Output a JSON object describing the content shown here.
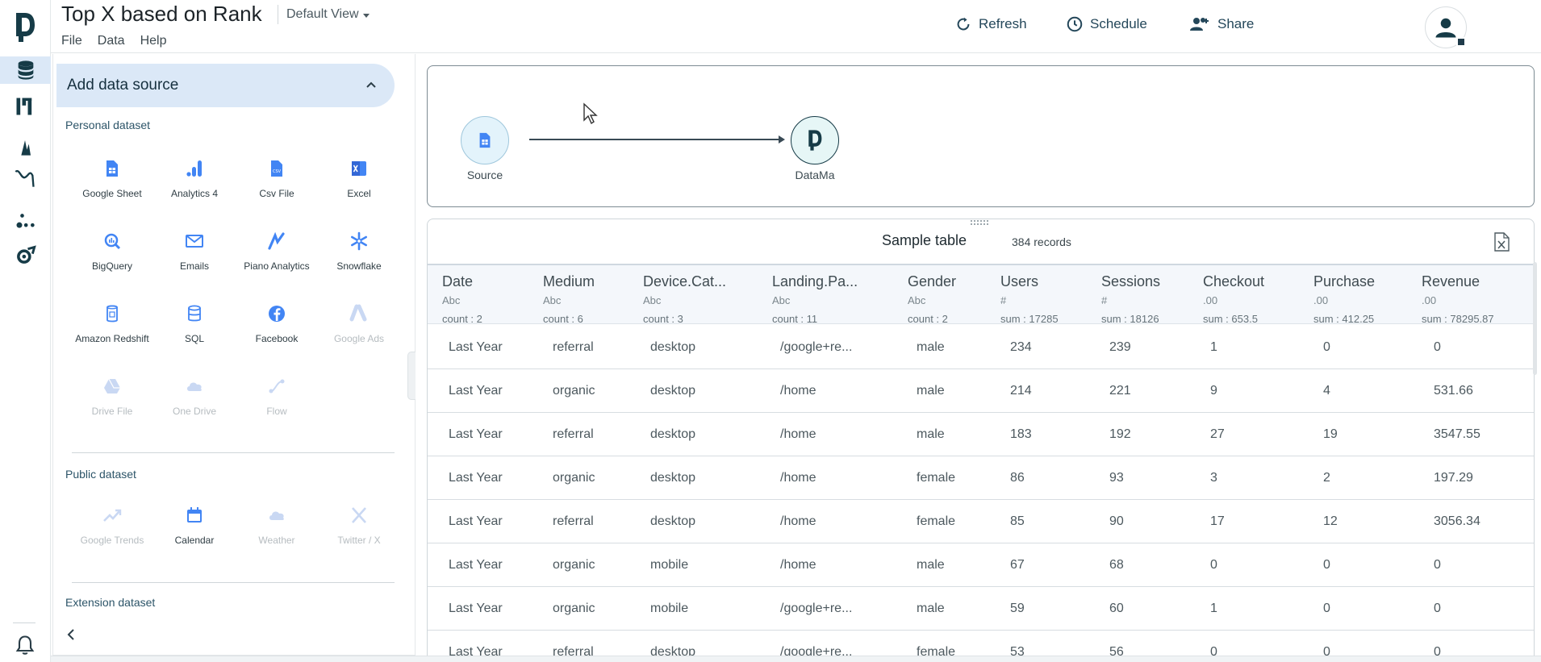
{
  "header": {
    "title": "Top X based on Rank",
    "view_label": "Default View",
    "menu": [
      "File",
      "Data",
      "Help"
    ],
    "refresh_label": "Refresh",
    "schedule_label": "Schedule",
    "share_label": "Share"
  },
  "panel": {
    "add_source_label": "Add data source",
    "personal_title": "Personal dataset",
    "personal": [
      {
        "label": "Google Sheet",
        "icon": "google-sheet-icon",
        "enabled": true
      },
      {
        "label": "Analytics 4",
        "icon": "analytics-icon",
        "enabled": true
      },
      {
        "label": "Csv File",
        "icon": "csv-file-icon",
        "enabled": true
      },
      {
        "label": "Excel",
        "icon": "excel-icon",
        "enabled": true
      },
      {
        "label": "BigQuery",
        "icon": "bigquery-icon",
        "enabled": true
      },
      {
        "label": "Emails",
        "icon": "email-icon",
        "enabled": true
      },
      {
        "label": "Piano Analytics",
        "icon": "piano-analytics-icon",
        "enabled": true
      },
      {
        "label": "Snowflake",
        "icon": "snowflake-icon",
        "enabled": true
      },
      {
        "label": "Amazon Redshift",
        "icon": "redshift-icon",
        "enabled": true
      },
      {
        "label": "SQL",
        "icon": "sql-database-icon",
        "enabled": true
      },
      {
        "label": "Facebook",
        "icon": "facebook-icon",
        "enabled": true
      },
      {
        "label": "Google Ads",
        "icon": "google-ads-icon",
        "enabled": false
      },
      {
        "label": "Drive File",
        "icon": "drive-icon",
        "enabled": false
      },
      {
        "label": "One Drive",
        "icon": "cloud-icon",
        "enabled": false
      },
      {
        "label": "Flow",
        "icon": "flow-icon",
        "enabled": false
      }
    ],
    "public_title": "Public dataset",
    "public": [
      {
        "label": "Google Trends",
        "icon": "trend-icon",
        "enabled": false
      },
      {
        "label": "Calendar",
        "icon": "calendar-icon",
        "enabled": true
      },
      {
        "label": "Weather",
        "icon": "cloud-icon",
        "enabled": false
      },
      {
        "label": "Twitter / X",
        "icon": "x-twitter-icon",
        "enabled": false
      }
    ],
    "extension_title": "Extension dataset"
  },
  "flow": {
    "source_label": "Source",
    "target_label": "DataMa"
  },
  "table": {
    "caption": "Sample table",
    "records": "384 records",
    "columns": [
      {
        "name": "Date",
        "type": "Abc",
        "agg": "count : 2"
      },
      {
        "name": "Medium",
        "type": "Abc",
        "agg": "count : 6"
      },
      {
        "name": "Device.Cat...",
        "type": "Abc",
        "agg": "count : 3"
      },
      {
        "name": "Landing.Pa...",
        "type": "Abc",
        "agg": "count : 11"
      },
      {
        "name": "Gender",
        "type": "Abc",
        "agg": "count : 2"
      },
      {
        "name": "Users",
        "type": "#",
        "agg": "sum : 17285"
      },
      {
        "name": "Sessions",
        "type": "#",
        "agg": "sum : 18126"
      },
      {
        "name": "Checkout",
        "type": ".00",
        "agg": "sum : 653.5"
      },
      {
        "name": "Purchase",
        "type": ".00",
        "agg": "sum : 412.25"
      },
      {
        "name": "Revenue",
        "type": ".00",
        "agg": "sum : 78295.87"
      }
    ],
    "rows": [
      [
        "Last Year",
        "referral",
        "desktop",
        "/google+re...",
        "male",
        "234",
        "239",
        "1",
        "0",
        "0"
      ],
      [
        "Last Year",
        "organic",
        "desktop",
        "/home",
        "male",
        "214",
        "221",
        "9",
        "4",
        "531.66"
      ],
      [
        "Last Year",
        "referral",
        "desktop",
        "/home",
        "male",
        "183",
        "192",
        "27",
        "19",
        "3547.55"
      ],
      [
        "Last Year",
        "organic",
        "desktop",
        "/home",
        "female",
        "86",
        "93",
        "3",
        "2",
        "197.29"
      ],
      [
        "Last Year",
        "referral",
        "desktop",
        "/home",
        "female",
        "85",
        "90",
        "17",
        "12",
        "3056.34"
      ],
      [
        "Last Year",
        "organic",
        "mobile",
        "/home",
        "male",
        "67",
        "68",
        "0",
        "0",
        "0"
      ],
      [
        "Last Year",
        "organic",
        "mobile",
        "/google+re...",
        "male",
        "59",
        "60",
        "1",
        "0",
        "0"
      ],
      [
        "Last Year",
        "referral",
        "desktop",
        "/google+re...",
        "female",
        "53",
        "56",
        "0",
        "0",
        "0"
      ]
    ]
  },
  "colors": {
    "accent": "#4285f4",
    "brand": "#163b47",
    "active_bg": "#dbe8f7"
  }
}
